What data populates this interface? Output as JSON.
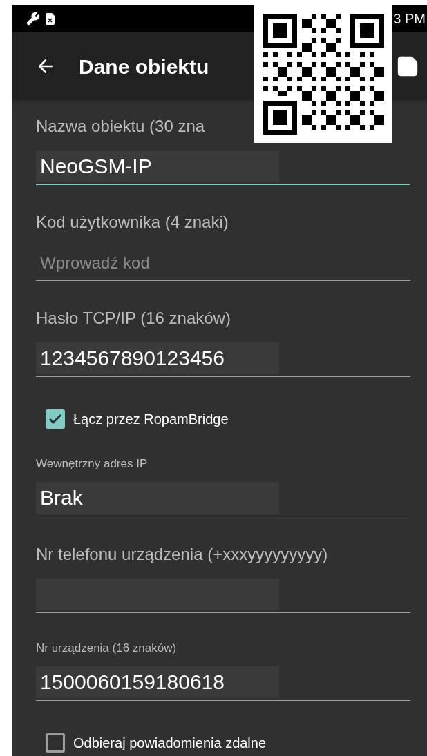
{
  "status_bar": {
    "time": "3 PM"
  },
  "toolbar": {
    "title": "Dane obiektu"
  },
  "items": [
    {
      "kind": "field",
      "label": "Nazwa obiektu (30 zna",
      "value": "NeoGSM-IP",
      "focused": true
    },
    {
      "kind": "field",
      "label": "Kod użytkownika (4 znaki)",
      "placeholder": "Wprowadź kod",
      "focused": false
    },
    {
      "kind": "field",
      "label": "Hasło TCP/IP (16 znaków)",
      "value": "1234567890123456",
      "focused": false
    },
    {
      "kind": "checkbox",
      "label": "Łącz przez RopamBridge",
      "checked": true
    },
    {
      "kind": "small_field",
      "label": "Wewnętrzny adres IP",
      "value": "Brak",
      "focused": false
    },
    {
      "kind": "field",
      "label": "Nr telefonu urządzenia (+xxxyyyyyyyyy)",
      "focused": false
    },
    {
      "kind": "small_field",
      "label": "Nr urządzenia (16 znaków)",
      "value": "1500060159180618",
      "focused": false
    },
    {
      "kind": "checkbox",
      "label": "Odbieraj powiadomienia zdalne",
      "checked": false
    }
  ]
}
